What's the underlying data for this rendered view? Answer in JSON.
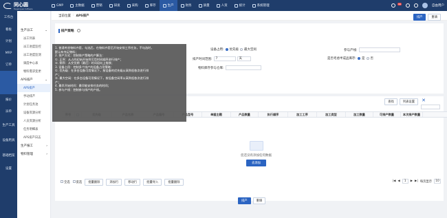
{
  "brand": {
    "name": "同心圆",
    "sub": "Tongxinyuan Software"
  },
  "nav": [
    {
      "label": "GMP",
      "icon": "gmp-icon"
    },
    {
      "label": "主数据",
      "icon": "data-icon"
    },
    {
      "label": "营销",
      "icon": "sales-icon"
    },
    {
      "label": "研发",
      "icon": "rd-icon"
    },
    {
      "label": "采购",
      "icon": "cart-icon"
    },
    {
      "label": "库存",
      "icon": "box-icon"
    },
    {
      "label": "生产",
      "icon": "factory-icon"
    },
    {
      "label": "财务",
      "icon": "finance-icon"
    },
    {
      "label": "质量",
      "icon": "quality-icon"
    },
    {
      "label": "人资",
      "icon": "people-icon"
    },
    {
      "label": "统计",
      "icon": "stats-icon"
    },
    {
      "label": "系统管理",
      "icon": "gear-icon"
    }
  ],
  "topright": {
    "badge": "99",
    "user": "自由用户"
  },
  "sidebar": [
    "工作台",
    "看板",
    "计划",
    "MRP",
    "订单",
    "",
    "",
    "报价",
    "派单",
    "生产工具",
    "设备用具",
    "基础档案",
    "设置"
  ],
  "subnav": {
    "group1": "生产派工",
    "items1": [
      "派工列表",
      "派工进度监控",
      "派工进度监测",
      "调度中心表",
      "物料需求变更"
    ],
    "group2": "APS排产",
    "items2": [
      "APS排产",
      "手动排产",
      "计划任务池",
      "设备资源分析",
      "人员资源分析",
      "任务明细表",
      "APS排产日志"
    ],
    "group3": "生产报工",
    "group4": "物料管理"
  },
  "breadcrumb": {
    "root": "当前位置",
    "page": "APS排产"
  },
  "head_btns": {
    "save": "排产",
    "reset": "重填"
  },
  "section_title": "排产策略",
  "form": {
    "device_label": "设备占用:",
    "device_opt1": "优先级",
    "device_opt2": "最大空闲",
    "participate_label": "参与产线:",
    "time_label": "排产时间范围:",
    "time_value": "7",
    "time_unit": "天",
    "consider_label": "是否考虑半成品库存:",
    "consider_yes": "是",
    "consider_no": "否",
    "stock_label": "物料库存参与仓库:"
  },
  "tooltip": [
    "1. 普通考虑物料齐套，勾选后，在物料齐套后开始安排工序任务，不勾选时，",
    "默认有充足物料；",
    "2. 排产方式：控制排产策略的产算法：",
    "①. 正序：从占的初始开始到可用时间顺序进行排产；",
    "②. 倒序：从交货期（最后）时间段向上推移；",
    "3. 设备占用：控制多个排产的设备占用策略：",
    "①. 优先级：在多台设备可用情况下，按设备的优先级从高到低依次进行排",
    "产；",
    "②. 最大空闲：在多台设备可用情况下，按设备空闲率从高到低依次进行排",
    "产；",
    "4. 最早开始时间：最早能安排任务的时间；",
    "5. 参与产线：控制参与排产的产线。"
  ],
  "table_tools": {
    "search": "查找",
    "col_setting": "列表设置"
  },
  "columns": [
    "序号",
    "",
    "优先级",
    "产品名称",
    "产品编号",
    "产品型号",
    "单据主题",
    "产品数量",
    "执行顺序",
    "加工工序",
    "加工类型",
    "加工数量",
    "可排产数量",
    "本次排产数量"
  ],
  "empty": {
    "text": "您还没有添加任何数据",
    "add": "去添加"
  },
  "footer": {
    "all": "全选",
    "invert": "反选",
    "delete": "批量删除",
    "add": "添加行",
    "move": "移动行",
    "import": "批量导入",
    "batch_delete": "批量删除"
  },
  "pager": {
    "total": "共 0 条",
    "page": "1",
    "size": "每页显示",
    "size_val": "10"
  },
  "bottom": {
    "submit": "排产",
    "reset": "重填"
  }
}
